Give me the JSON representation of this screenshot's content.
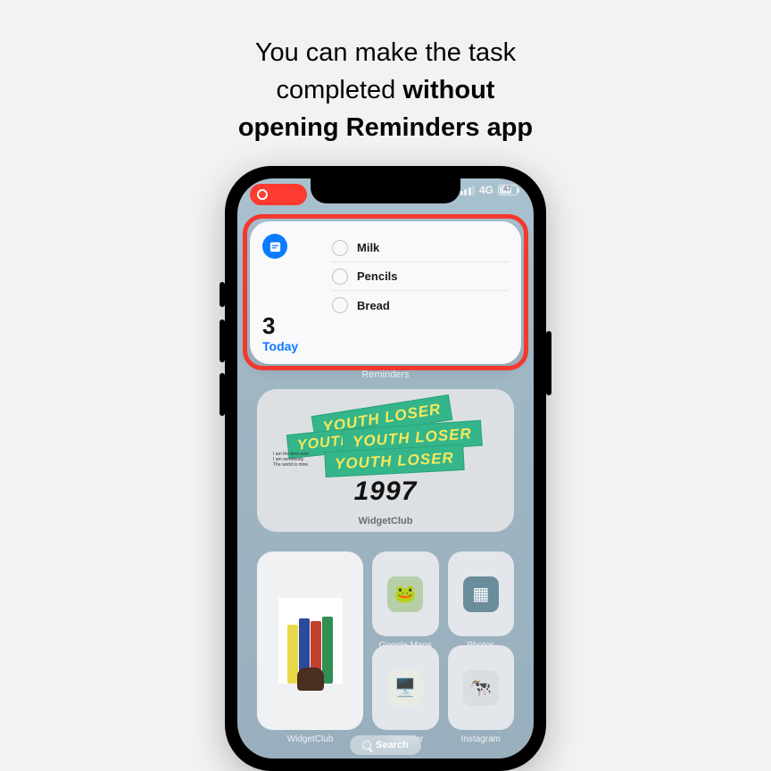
{
  "headline": {
    "line1": "You can make the task",
    "line2a": "completed ",
    "line2b": "without",
    "line3": "opening Reminders app"
  },
  "status": {
    "network": "4G",
    "battery_pct": "47"
  },
  "reminders_widget": {
    "count": "3",
    "today_label": "Today",
    "caption": "Reminders",
    "items": [
      {
        "text": "Milk"
      },
      {
        "text": "Pencils"
      },
      {
        "text": "Bread"
      }
    ]
  },
  "big_widget": {
    "sticker_text_1": "YOUTH LOSER",
    "sticker_text_2": "YOUTH L",
    "sticker_text_3": "YOUTH LOSER",
    "sticker_text_4": "YOUTH LOSER",
    "year": "1997",
    "caption": "WidgetClub"
  },
  "apps": {
    "big_label": "WidgetClub",
    "gm_label": "Google Maps",
    "ph_label": "Photos",
    "cal_label": "Calendar",
    "ig_label": "Instagram"
  },
  "search": {
    "label": "Search"
  }
}
